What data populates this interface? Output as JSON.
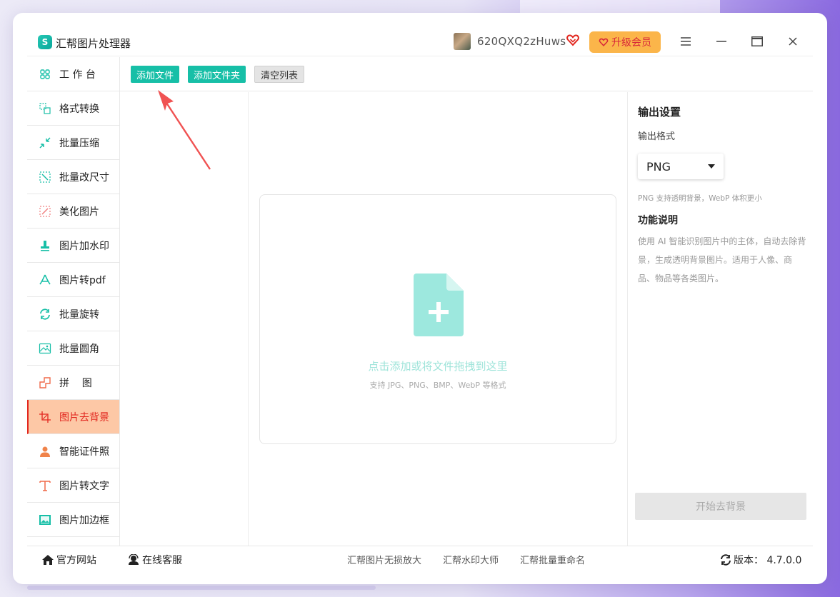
{
  "app": {
    "title": "汇帮图片处理器",
    "logo_glyph": "S"
  },
  "header": {
    "username": "620QXQ2zHuws",
    "upgrade_label": "升级会员",
    "accent": "#17bfa7",
    "vip_color": "#e2261e"
  },
  "sidebar": {
    "items": [
      {
        "label": "工 作 台",
        "icon": "grid-icon"
      },
      {
        "label": "格式转换",
        "icon": "convert-icon"
      },
      {
        "label": "批量压缩",
        "icon": "compress-icon"
      },
      {
        "label": "批量改尺寸",
        "icon": "resize-icon"
      },
      {
        "label": "美化图片",
        "icon": "beautify-icon"
      },
      {
        "label": "图片加水印",
        "icon": "watermark-icon"
      },
      {
        "label": "图片转pdf",
        "icon": "pdf-icon"
      },
      {
        "label": "批量旋转",
        "icon": "rotate-icon"
      },
      {
        "label": "批量圆角",
        "icon": "rounded-corner-icon"
      },
      {
        "label": "拼    图",
        "icon": "collage-icon"
      },
      {
        "label": "图片去背景",
        "icon": "crop-icon",
        "active": true
      },
      {
        "label": "智能证件照",
        "icon": "person-icon"
      },
      {
        "label": "图片转文字",
        "icon": "text-icon"
      },
      {
        "label": "图片加边框",
        "icon": "frame-icon"
      }
    ]
  },
  "toolbar": {
    "add_file": "添加文件",
    "add_folder": "添加文件夹",
    "clear_list": "清空列表"
  },
  "dropzone": {
    "main_text": "点击添加或将文件拖拽到这里",
    "sub_text": "支持 JPG、PNG、BMP、WebP 等格式"
  },
  "right_panel": {
    "output_title": "输出设置",
    "format_label": "输出格式",
    "format_value": "PNG",
    "format_hint": "PNG 支持透明背景，WebP 体积更小",
    "feature_title": "功能说明",
    "feature_desc": "使用 AI 智能识别图片中的主体，自动去除背景，生成透明背景图片。适用于人像、商品、物品等各类图片。",
    "start_button": "开始去背景"
  },
  "footer": {
    "website": "官方网站",
    "support": "在线客服",
    "links": [
      "汇帮图片无损放大",
      "汇帮水印大师",
      "汇帮批量重命名"
    ],
    "version": "版本： 4.7.0.0"
  }
}
